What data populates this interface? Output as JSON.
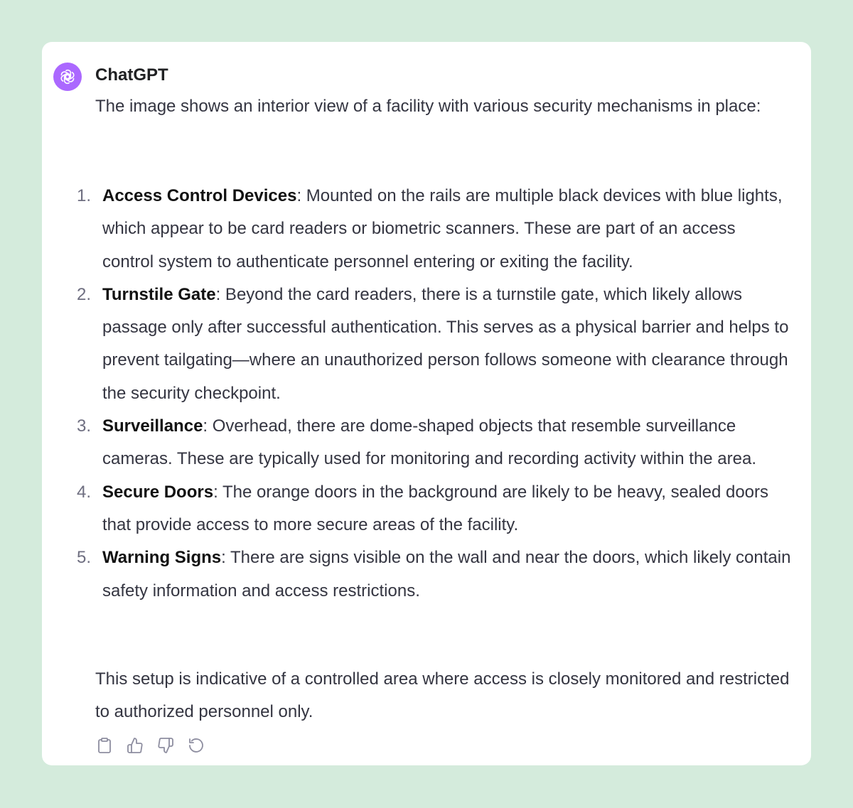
{
  "message": {
    "author": "ChatGPT",
    "intro": "The image shows an interior view of a facility with various security mechanisms in place:",
    "items": [
      {
        "number": "1.",
        "title": "Access Control Devices",
        "text": ": Mounted on the rails are multiple black devices with blue lights, which appear to be card readers or biometric scanners. These are part of an access control system to authenticate personnel entering or exiting the facility."
      },
      {
        "number": "2.",
        "title": "Turnstile Gate",
        "text": ": Beyond the card readers, there is a turnstile gate, which likely allows passage only after successful authentication. This serves as a physical barrier and helps to prevent tailgating—where an unauthorized person follows someone with clearance through the security checkpoint."
      },
      {
        "number": "3.",
        "title": "Surveillance",
        "text": ": Overhead, there are dome-shaped objects that resemble surveillance cameras. These are typically used for monitoring and recording activity within the area."
      },
      {
        "number": "4.",
        "title": "Secure Doors",
        "text": ": The orange doors in the background are likely to be heavy, sealed doors that provide access to more secure areas of the facility."
      },
      {
        "number": "5.",
        "title": "Warning Signs",
        "text": ": There are signs visible on the wall and near the doors, which likely contain safety information and access restrictions."
      }
    ],
    "outro": "This setup is indicative of a controlled area where access is closely monitored and restricted to authorized personnel only."
  },
  "actions": [
    {
      "icon": "clipboard-icon"
    },
    {
      "icon": "thumbs-up-icon"
    },
    {
      "icon": "thumbs-down-icon"
    },
    {
      "icon": "regenerate-icon"
    }
  ],
  "colors": {
    "background": "#d4ebdc",
    "card": "#ffffff",
    "avatar": "#ab68ff",
    "text": "#343541",
    "muted": "#6e6e80"
  }
}
